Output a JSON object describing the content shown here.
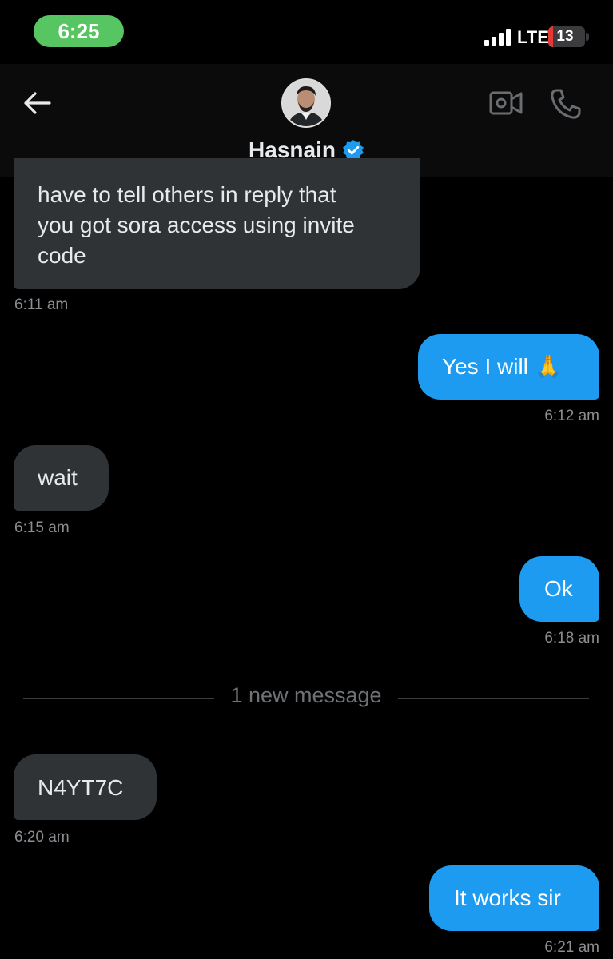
{
  "status_bar": {
    "time": "6:25",
    "network": "LTE",
    "battery": "13",
    "battery_level": 0.13,
    "colors": {
      "time_pill": "#57c561",
      "battery_low": "#e53935"
    }
  },
  "header": {
    "contact_name": "Hasnain",
    "verified": true,
    "icons": [
      "back-arrow-icon",
      "video-call-icon",
      "phone-call-icon",
      "verified-badge-icon"
    ],
    "colors": {
      "verified": "#1d9bf0"
    }
  },
  "messages": [
    {
      "direction": "incoming",
      "lines": [
        "have to tell others in reply that",
        "you got sora access using invite",
        "code"
      ],
      "time": "6:11 am"
    },
    {
      "direction": "outgoing",
      "text": "Yes I will 🙏",
      "time": "6:12 am"
    },
    {
      "direction": "incoming",
      "text": "wait",
      "time": "6:15 am"
    },
    {
      "direction": "outgoing",
      "text": "Ok",
      "time": "6:18 am"
    },
    {
      "direction": "incoming",
      "text": "N4YT7C",
      "time": "6:20 am"
    },
    {
      "direction": "outgoing",
      "text": "It works sir",
      "time": "6:21 am"
    }
  ],
  "divider": {
    "label": "1 new message"
  },
  "colors": {
    "incoming_bubble": "#2f3336",
    "outgoing_bubble": "#1d9bf0",
    "background": "#000000"
  }
}
